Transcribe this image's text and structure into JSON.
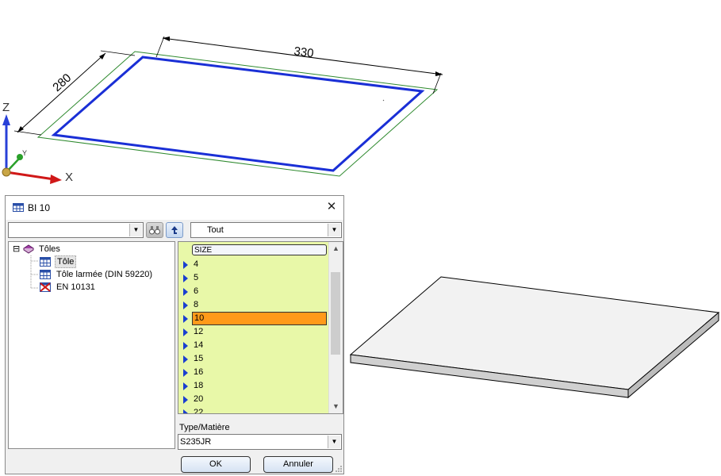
{
  "drawing": {
    "dim_width": "330",
    "dim_height": "280",
    "axis_z": "Z",
    "axis_y": "Y",
    "axis_x": "X",
    "colors": {
      "outline": "#1a2fd6",
      "plate_edge": "#2f8a2f",
      "axis_z": "#2840d8",
      "axis_x": "#d01818",
      "axis_y": "#2aa02a"
    }
  },
  "dialog": {
    "title": "BI 10",
    "close_glyph": "✕",
    "filter_combo_value": "",
    "category_combo_value": "Tout",
    "tree": {
      "root": "Tôles",
      "children": [
        "Tôle",
        "Tôle larmée (DIN 59220)",
        "EN 10131"
      ],
      "expander": "⊟"
    },
    "list": {
      "header": "SIZE",
      "items": [
        "4",
        "5",
        "6",
        "8",
        "10",
        "12",
        "14",
        "15",
        "16",
        "18",
        "20",
        "22"
      ],
      "selected": "10"
    },
    "type_label": "Type/Matière",
    "type_value": "S235JR",
    "ok_label": "OK",
    "cancel_label": "Annuler"
  }
}
